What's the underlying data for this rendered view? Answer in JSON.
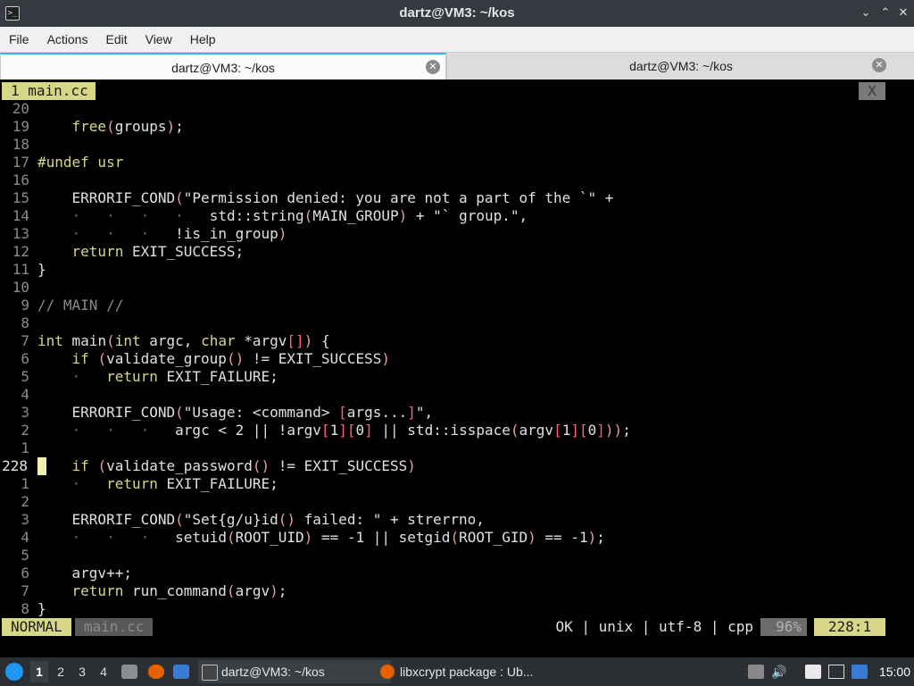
{
  "window": {
    "title": "dartz@VM3: ~/kos",
    "app_icon": "terminal-icon"
  },
  "menu": [
    "File",
    "Actions",
    "Edit",
    "View",
    "Help"
  ],
  "tabs": [
    {
      "label": "dartz@VM3: ~/kos",
      "active": true
    },
    {
      "label": "dartz@VM3: ~/kos",
      "active": false
    }
  ],
  "vim": {
    "tab_label": "1 main.cc",
    "tab_close": "X",
    "lines": [
      {
        "n": "20",
        "t": ""
      },
      {
        "n": "19",
        "t": "    free(groups);"
      },
      {
        "n": "18",
        "t": ""
      },
      {
        "n": "17",
        "t": "#undef usr"
      },
      {
        "n": "16",
        "t": ""
      },
      {
        "n": "15",
        "t": "    ERRORIF_COND(\"Permission denied: you are not a part of the `\" +"
      },
      {
        "n": "14",
        "t": "    ·   ·   ·   ·   std::string(MAIN_GROUP) + \"` group.\","
      },
      {
        "n": "13",
        "t": "    ·   ·   ·   !is_in_group)"
      },
      {
        "n": "12",
        "t": "    return EXIT_SUCCESS;"
      },
      {
        "n": "11",
        "t": "}"
      },
      {
        "n": "10",
        "t": ""
      },
      {
        "n": "9",
        "t": "// MAIN //"
      },
      {
        "n": "8",
        "t": ""
      },
      {
        "n": "7",
        "t": "int main(int argc, char *argv[]) {"
      },
      {
        "n": "6",
        "t": "    if (validate_group() != EXIT_SUCCESS)"
      },
      {
        "n": "5",
        "t": "    ·   return EXIT_FAILURE;"
      },
      {
        "n": "4",
        "t": ""
      },
      {
        "n": "3",
        "t": "    ERRORIF_COND(\"Usage: <command> [args...]\","
      },
      {
        "n": "2",
        "t": "    ·   ·   ·   argc < 2 || !argv[1][0] || std::isspace(argv[1][0]));"
      },
      {
        "n": "1",
        "t": ""
      },
      {
        "n": "228",
        "t": "    if (validate_password() != EXIT_SUCCESS)",
        "current": true
      },
      {
        "n": "1",
        "t": "    ·   return EXIT_FAILURE;"
      },
      {
        "n": "2",
        "t": ""
      },
      {
        "n": "3",
        "t": "    ERRORIF_COND(\"Set{g/u}id() failed: \" + strerrno,"
      },
      {
        "n": "4",
        "t": "    ·   ·   ·   setuid(ROOT_UID) == -1 || setgid(ROOT_GID) == -1);"
      },
      {
        "n": "5",
        "t": ""
      },
      {
        "n": "6",
        "t": "    argv++;"
      },
      {
        "n": "7",
        "t": "    return run_command(argv);"
      },
      {
        "n": "8",
        "t": "}"
      }
    ],
    "status": {
      "mode": "NORMAL",
      "file": "main.cc",
      "info": "OK | unix | utf-8 | cpp",
      "percent": "96%",
      "position": "228:1"
    }
  },
  "taskbar": {
    "workspaces": [
      "1",
      "2",
      "3",
      "4"
    ],
    "active_workspace": "1",
    "tasks": [
      {
        "label": "dartz@VM3: ~/kos",
        "icon": "terminal-icon",
        "active": true
      },
      {
        "label": "libxcrypt package : Ub...",
        "icon": "firefox-icon",
        "active": false
      }
    ],
    "clock": "15:00"
  },
  "colors": {
    "accent": "#3daee9",
    "vim_yellow": "#d7d787",
    "terminal_bg": "#000000",
    "titlebar": "#353a40",
    "taskbar": "#2b2f34"
  }
}
